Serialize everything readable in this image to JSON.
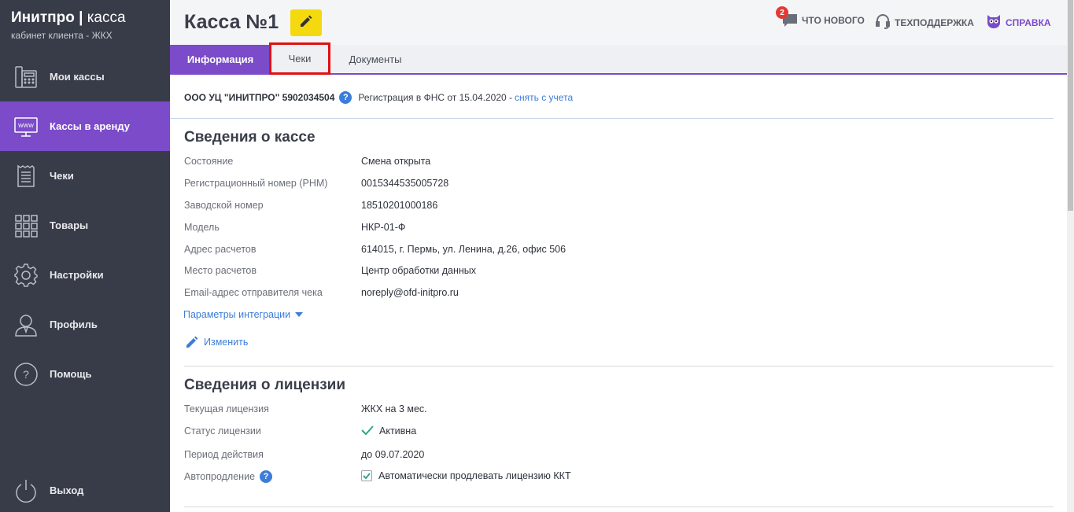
{
  "brand": {
    "title_bold": "Инитпро",
    "title_sep": " | ",
    "title_thin": "касса",
    "subtitle": "кабинет клиента - ЖКХ"
  },
  "sidebar": {
    "items": [
      {
        "label": "Мои кассы",
        "icon": "cash-register-icon"
      },
      {
        "label": "Кассы в аренду",
        "icon": "www-monitor-icon",
        "active": true
      },
      {
        "label": "Чеки",
        "icon": "receipt-icon"
      },
      {
        "label": "Товары",
        "icon": "grid-icon"
      },
      {
        "label": "Настройки",
        "icon": "gear-icon"
      },
      {
        "label": "Профиль",
        "icon": "user-icon"
      },
      {
        "label": "Помощь",
        "icon": "question-icon"
      }
    ],
    "logout": {
      "label": "Выход",
      "icon": "power-icon"
    }
  },
  "header": {
    "title": "Касса №1",
    "whats_new": {
      "label": "Что нового",
      "badge": "2"
    },
    "support": {
      "label": "Техподдержка"
    },
    "help": {
      "label": "Справка"
    }
  },
  "tabs": [
    {
      "label": "Информация",
      "active": true
    },
    {
      "label": "Чеки",
      "highlighted": true
    },
    {
      "label": "Документы"
    }
  ],
  "org": {
    "name": "ООО УЦ \"ИНИТПРО\" 5902034504",
    "registration": "Регистрация в ФНС от 15.04.2020 - ",
    "deregister_link": "снять с учета"
  },
  "kassa_info": {
    "title": "Сведения о кассе",
    "rows": [
      {
        "label": "Состояние",
        "value": "Смена открыта"
      },
      {
        "label": "Регистрационный номер (РНМ)",
        "value": "0015344535005728"
      },
      {
        "label": "Заводской номер",
        "value": "18510201000186"
      },
      {
        "label": "Модель",
        "value": "НКР-01-Ф"
      },
      {
        "label": "Адрес расчетов",
        "value": "614015, г. Пермь, ул. Ленина, д.26, офис 506"
      },
      {
        "label": "Место расчетов",
        "value": "Центр обработки данных"
      },
      {
        "label": "Email-адрес отправителя чека",
        "value": "noreply@ofd-initpro.ru"
      }
    ],
    "integration_link": "Параметры интеграции",
    "edit_link": "Изменить"
  },
  "license_info": {
    "title": "Сведения о лицензии",
    "current_label": "Текущая лицензия",
    "current_value": "ЖКХ на 3 мес.",
    "status_label": "Статус лицензии",
    "status_value": "Активна",
    "period_label": "Период действия",
    "period_value": "до 09.07.2020",
    "autorenew_label": "Автопродление",
    "autorenew_value": "Автоматически продлевать лицензию ККТ",
    "autorenew_checked": true
  },
  "colors": {
    "sidebar_bg": "#383c48",
    "accent": "#7b4bc9",
    "edit_button": "#f5d90f",
    "link": "#3b7dd8",
    "badge": "#e53935",
    "check": "#2ea58a"
  }
}
